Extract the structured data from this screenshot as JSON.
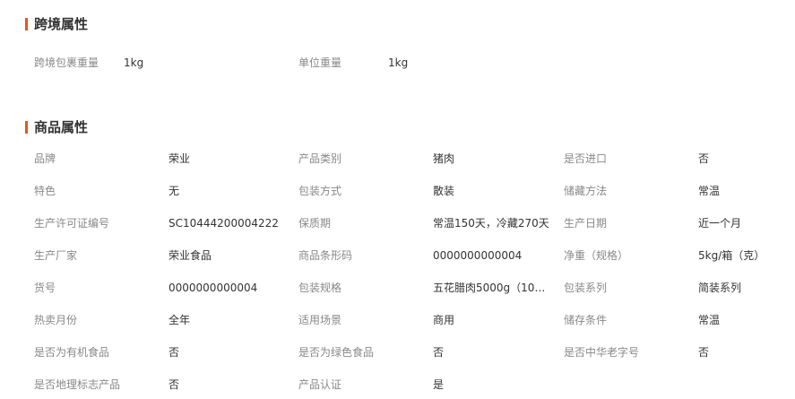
{
  "cross_border": {
    "title": "跨境属性",
    "items": [
      {
        "label": "跨境包裹重量",
        "value": "1kg"
      },
      {
        "label": "单位重量",
        "value": "1kg"
      }
    ]
  },
  "product": {
    "title": "商品属性",
    "items": [
      {
        "label": "品牌",
        "value": "荣业"
      },
      {
        "label": "产品类别",
        "value": "猪肉"
      },
      {
        "label": "是否进口",
        "value": "否"
      },
      {
        "label": "特色",
        "value": "无"
      },
      {
        "label": "包装方式",
        "value": "散装"
      },
      {
        "label": "储藏方法",
        "value": "常温"
      },
      {
        "label": "生产许可证编号",
        "value": "SC10444200004222"
      },
      {
        "label": "保质期",
        "value": "常温150天，冷藏270天"
      },
      {
        "label": "生产日期",
        "value": "近一个月"
      },
      {
        "label": "生产厂家",
        "value": "荣业食品"
      },
      {
        "label": "商品条形码",
        "value": "0000000000004"
      },
      {
        "label": "净重（规格）",
        "value": "5kg/箱（克）"
      },
      {
        "label": "货号",
        "value": "0000000000004"
      },
      {
        "label": "包装规格",
        "value": "五花腊肉5000g（10…"
      },
      {
        "label": "包装系列",
        "value": "简装系列"
      },
      {
        "label": "热卖月份",
        "value": "全年"
      },
      {
        "label": "适用场景",
        "value": "商用"
      },
      {
        "label": "储存条件",
        "value": "常温"
      },
      {
        "label": "是否为有机食品",
        "value": "否"
      },
      {
        "label": "是否为绿色食品",
        "value": "否"
      },
      {
        "label": "是否中华老字号",
        "value": "否"
      },
      {
        "label": "是否地理标志产品",
        "value": "否"
      },
      {
        "label": "产品认证",
        "value": "是"
      }
    ]
  },
  "colors": {
    "accent": "#e4561a",
    "title": "#333333",
    "label": "#888888",
    "value": "#333333"
  }
}
